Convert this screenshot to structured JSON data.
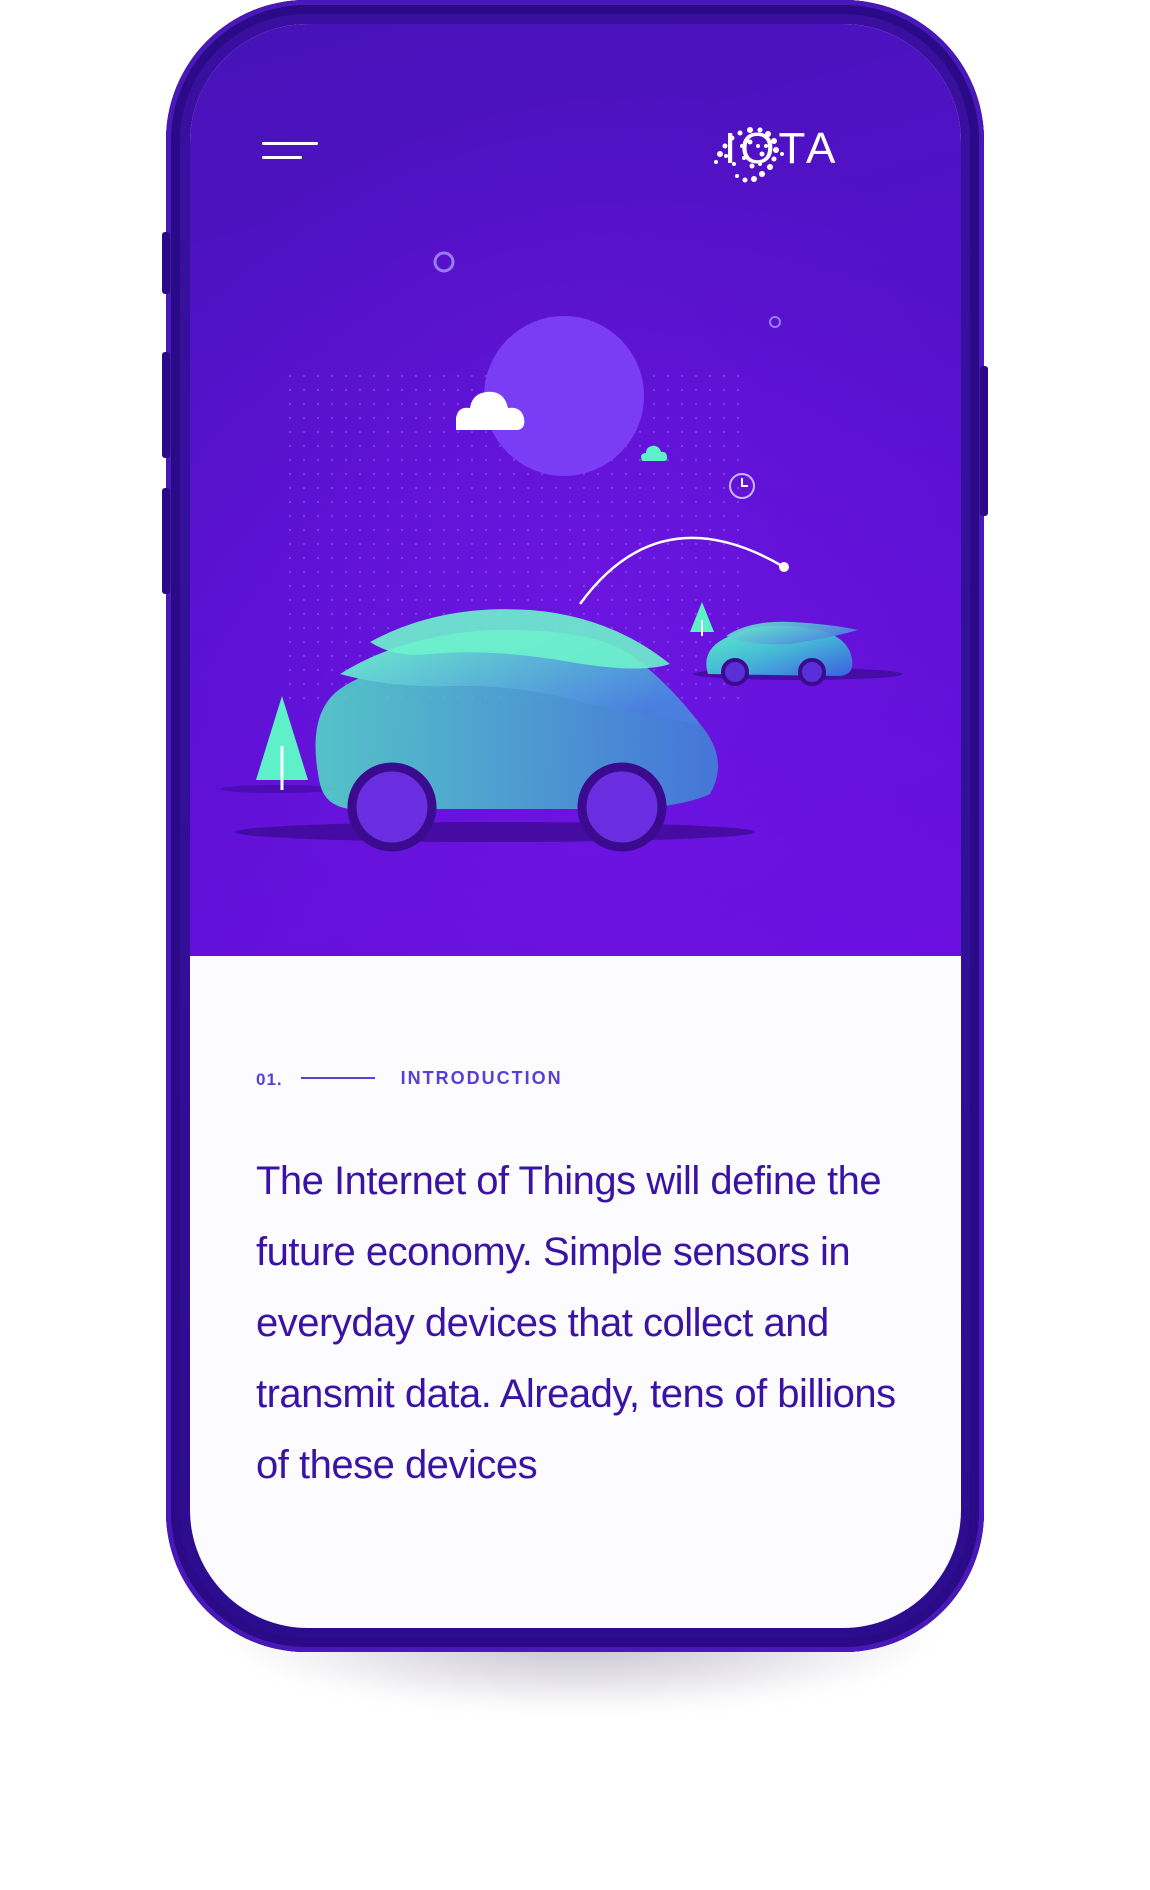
{
  "brand": {
    "logo_text": "IOTA"
  },
  "header": {
    "menu_icon": "hamburger-menu-icon",
    "logo_icon": "iota-dots-logo-icon"
  },
  "illustration": {
    "elements": [
      "moon",
      "cloud",
      "small-cloud",
      "large-car",
      "small-car",
      "trees",
      "connection-arc",
      "clock-icon",
      "dot-grid"
    ]
  },
  "section": {
    "number": "01.",
    "label": "INTRODUCTION"
  },
  "intro": {
    "text": "The Internet of Things will define the future economy. Simple sensors in everyday devices that collect and transmit data. Already, tens of billions of these devices"
  },
  "colors": {
    "phone_frame": "#3a0fa0",
    "hero_top": "#4712b8",
    "hero_bottom": "#6a0fe0",
    "accent_text": "#3a12a6",
    "section_label": "#5a3fd6",
    "car_teal": "#5ef0c8",
    "car_blue": "#3a6fd8",
    "moon": "#7a3cf5"
  }
}
